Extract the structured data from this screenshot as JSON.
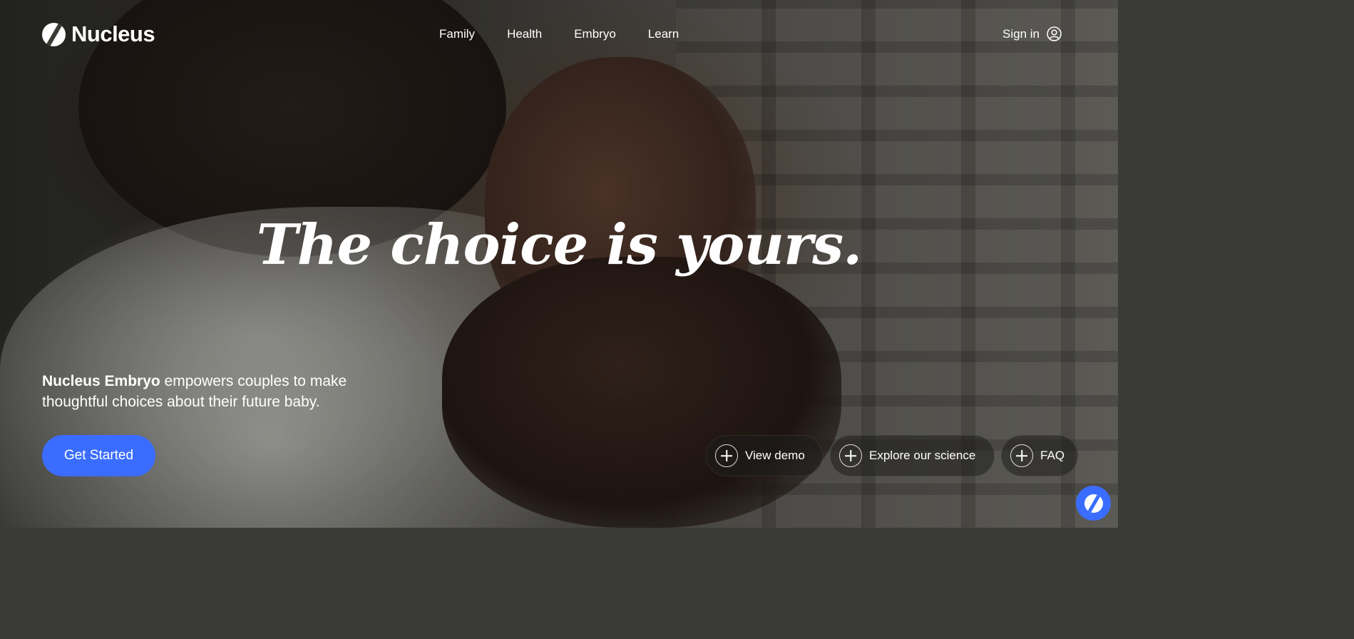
{
  "brand": {
    "name": "Nucleus",
    "logo_icon": "nucleus-logo-icon"
  },
  "nav": {
    "items": [
      "Family",
      "Health",
      "Embryo",
      "Learn"
    ]
  },
  "header": {
    "sign_in_label": "Sign in",
    "user_icon": "user-circle-icon"
  },
  "hero": {
    "headline": "The choice is yours.",
    "tagline_bold": "Nucleus Embryo",
    "tagline_rest": " empowers couples to make thoughtful choices about their future baby.",
    "cta_label": "Get Started"
  },
  "actions": [
    {
      "label": "View demo",
      "icon": "plus-icon"
    },
    {
      "label": "Explore our science",
      "icon": "plus-icon"
    },
    {
      "label": "FAQ",
      "icon": "plus-icon"
    }
  ],
  "chat": {
    "icon": "nucleus-chat-icon"
  },
  "colors": {
    "accent": "#3a6dff",
    "text": "#ffffff"
  }
}
